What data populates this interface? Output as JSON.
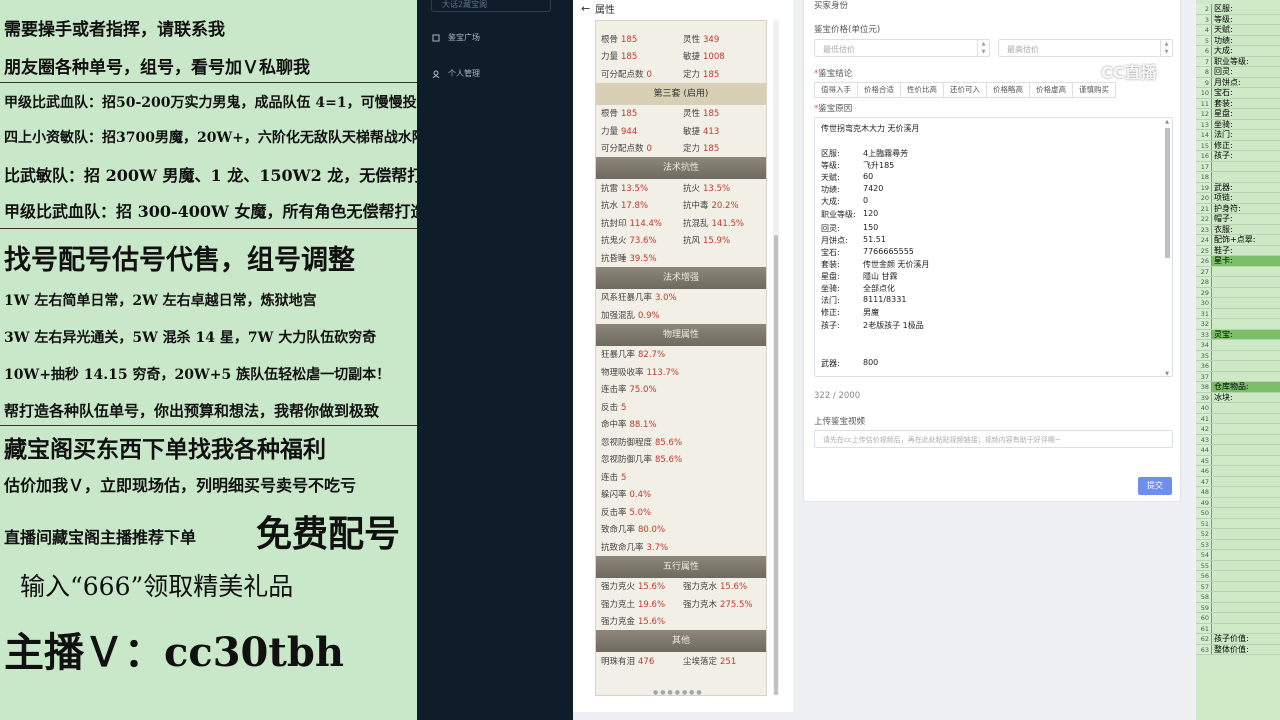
{
  "ad_panel": {
    "lines": [
      "需要操手或者指挥，请联系我",
      "朋友圈各种单号，组号，看号加Ｖ私聊我",
      "甲级比武血队：招50-200万实力男鬼，成品队伍 4=1，可慢慢投资",
      "四上小资敏队：招3700男魔，20W+，六阶化无敌队天梯帮战水陆 4 等 1",
      "比武敏队：招 200W 男魔、1 龙、150W2 龙，无偿帮打造",
      "甲级比武血队：招 300-400W 女魔，所有角色无偿帮打造",
      "找号配号估号代售，组号调整",
      "1W 左右简单日常，2W 左右卓越日常，炼狱地宫",
      "3W 左右异光通关，5W 混杀 14 星，7W 大力队伍砍穷奇",
      "10W+抽秒 14.15 穷奇，20W+5 族队伍轻松虐一切副本！",
      "帮打造各种队伍单号，你出预算和想法，我帮你做到极致",
      "藏宝阁买东西下单找我各种福利",
      "估价加我Ｖ，立即现场估，列明细买号卖号不吃亏",
      "直播间藏宝阁主播推荐下单",
      "免费配号",
      "输入“666”领取精美礼品",
      "主播Ｖ：cc30tbh"
    ]
  },
  "nav": {
    "top_box": "大话2藏宝阁",
    "items": [
      {
        "label": "鉴宝广场",
        "icon": "plaza-icon"
      },
      {
        "label": "个人管理",
        "icon": "user-icon"
      }
    ]
  },
  "props_panel": {
    "title": "属性",
    "set2_rows": [
      [
        {
          "k": "根骨",
          "v": "185"
        },
        {
          "k": "灵性",
          "v": "349"
        }
      ],
      [
        {
          "k": "力量",
          "v": "185"
        },
        {
          "k": "敏捷",
          "v": "1008"
        }
      ],
      [
        {
          "k": "可分配点数",
          "v": "0"
        },
        {
          "k": "定力",
          "v": "185"
        }
      ]
    ],
    "set3_title": "第三套 (启用)",
    "set3_rows": [
      [
        {
          "k": "根骨",
          "v": "185"
        },
        {
          "k": "灵性",
          "v": "185"
        }
      ],
      [
        {
          "k": "力量",
          "v": "944"
        },
        {
          "k": "敏捷",
          "v": "413"
        }
      ],
      [
        {
          "k": "可分配点数",
          "v": "0"
        },
        {
          "k": "定力",
          "v": "185"
        }
      ]
    ],
    "resist_title": "法术抗性",
    "resist_rows": [
      [
        {
          "k": "抗雷",
          "v": "13.5%"
        },
        {
          "k": "抗火",
          "v": "13.5%"
        }
      ],
      [
        {
          "k": "抗水",
          "v": "17.8%"
        },
        {
          "k": "抗中毒",
          "v": "20.2%"
        }
      ],
      [
        {
          "k": "抗封印",
          "v": "114.4%"
        },
        {
          "k": "抗混乱",
          "v": "141.5%"
        }
      ],
      [
        {
          "k": "抗鬼火",
          "v": "73.6%"
        },
        {
          "k": "抗风",
          "v": "15.9%"
        }
      ],
      [
        {
          "k": "抗昏睡",
          "v": "39.5%"
        }
      ]
    ],
    "boost_title": "法术增强",
    "boost_rows": [
      [
        {
          "k": "风系狂暴几率",
          "v": "3.0%"
        }
      ],
      [
        {
          "k": "加强混乱",
          "v": "0.9%"
        }
      ]
    ],
    "phys_title": "物理属性",
    "phys_rows": [
      [
        {
          "k": "狂暴几率",
          "v": "82.7%"
        }
      ],
      [
        {
          "k": "物理吸收率",
          "v": "113.7%"
        }
      ],
      [
        {
          "k": "连击率",
          "v": "75.0%"
        }
      ],
      [
        {
          "k": "反击",
          "v": "5"
        }
      ],
      [
        {
          "k": "命中率",
          "v": "88.1%"
        }
      ],
      [
        {
          "k": "忽视防御程度",
          "v": "85.6%"
        }
      ],
      [
        {
          "k": "忽视防御几率",
          "v": "85.6%"
        }
      ],
      [
        {
          "k": "连击",
          "v": "5"
        }
      ],
      [
        {
          "k": "躲闪率",
          "v": "0.4%"
        }
      ],
      [
        {
          "k": "反击率",
          "v": "5.0%"
        }
      ],
      [
        {
          "k": "致命几率",
          "v": "80.0%"
        }
      ],
      [
        {
          "k": "抗致命几率",
          "v": "3.7%"
        }
      ]
    ],
    "elem_title": "五行属性",
    "elem_rows": [
      [
        {
          "k": "强力克火",
          "v": "15.6%"
        },
        {
          "k": "强力克水",
          "v": "15.6%"
        }
      ],
      [
        {
          "k": "强力克土",
          "v": "19.6%"
        },
        {
          "k": "强力克木",
          "v": "275.5%"
        }
      ],
      [
        {
          "k": "强力克金",
          "v": "15.6%"
        }
      ]
    ],
    "other_title": "其他",
    "other_rows": [
      [
        {
          "k": "明珠有泪",
          "v": "476"
        },
        {
          "k": "尘埃落定",
          "v": "251"
        }
      ]
    ]
  },
  "form": {
    "section_title": "买家身份",
    "price_label": "鉴宝价格(单位元)",
    "min_placeholder": "最低估价",
    "max_placeholder": "最高估价",
    "conclusion_label": "鉴宝结论",
    "tags": [
      "值得入手",
      "价格合适",
      "性价比高",
      "还价可入",
      "价格略高",
      "价格虚高",
      "谨慎购买"
    ],
    "reason_label": "鉴宝原因",
    "reason_title": "传世拐弯克木大力 无价溪月",
    "reason_rows": [
      {
        "k": "区服:",
        "v": "4上臨霧尋芳"
      },
      {
        "k": "等级:",
        "v": "飞升185"
      },
      {
        "k": "天赋:",
        "v": "60"
      },
      {
        "k": "功绩:",
        "v": "7420"
      },
      {
        "k": "大成:",
        "v": "0"
      },
      {
        "k": "职业等级:",
        "v": "120"
      },
      {
        "k": "回灵:",
        "v": "150"
      },
      {
        "k": "月饼点:",
        "v": "51.51"
      },
      {
        "k": "宝石:",
        "v": "7766665555"
      },
      {
        "k": "套装:",
        "v": "传世金颜 无价溪月"
      },
      {
        "k": "星盘:",
        "v": "隱山 甘霖"
      },
      {
        "k": "坐骑:",
        "v": "全部点化"
      },
      {
        "k": "法门:",
        "v": "8111/8331"
      },
      {
        "k": "修正:",
        "v": "男魔"
      },
      {
        "k": "孩子:",
        "v": "2老版孩子 1极品"
      },
      {
        "k": "武器:",
        "v": "800"
      }
    ],
    "char_count": "322 / 2000",
    "video_label": "上传鉴宝视频",
    "video_placeholder": "请先在cc上传估价视频后，再在此处粘贴视频链接；视频内容有助于好评噢~",
    "submit_label": "提交"
  },
  "watermark": "CC直播",
  "sheet": {
    "rows": [
      {
        "n": "2",
        "c": "区服:"
      },
      {
        "n": "3",
        "c": "等级:"
      },
      {
        "n": "4",
        "c": "天赋:"
      },
      {
        "n": "5",
        "c": "功绩:"
      },
      {
        "n": "6",
        "c": "大成:"
      },
      {
        "n": "7",
        "c": "职业等级:"
      },
      {
        "n": "8",
        "c": "回灵:"
      },
      {
        "n": "9",
        "c": "月饼点:"
      },
      {
        "n": "10",
        "c": "宝石:"
      },
      {
        "n": "11",
        "c": "套装:"
      },
      {
        "n": "12",
        "c": "星盘:"
      },
      {
        "n": "13",
        "c": "坐骑:"
      },
      {
        "n": "14",
        "c": "法门:"
      },
      {
        "n": "15",
        "c": "修正:"
      },
      {
        "n": "16",
        "c": "孩子:"
      },
      {
        "n": "17",
        "c": ""
      },
      {
        "n": "18",
        "c": ""
      },
      {
        "n": "19",
        "c": "武器:"
      },
      {
        "n": "20",
        "c": "项链:"
      },
      {
        "n": "21",
        "c": "护身符:"
      },
      {
        "n": "22",
        "c": "帽子:"
      },
      {
        "n": "23",
        "c": "衣服:"
      },
      {
        "n": "24",
        "c": "配饰+点翠:"
      },
      {
        "n": "25",
        "c": "鞋子:"
      },
      {
        "n": "26",
        "c": "星卡:",
        "hl": true
      },
      {
        "n": "27",
        "c": ""
      },
      {
        "n": "28",
        "c": ""
      },
      {
        "n": "29",
        "c": ""
      },
      {
        "n": "30",
        "c": ""
      },
      {
        "n": "31",
        "c": ""
      },
      {
        "n": "32",
        "c": ""
      },
      {
        "n": "33",
        "c": "灵宝:",
        "hl": true
      },
      {
        "n": "34",
        "c": ""
      },
      {
        "n": "35",
        "c": ""
      },
      {
        "n": "36",
        "c": ""
      },
      {
        "n": "37",
        "c": ""
      },
      {
        "n": "38",
        "c": "仓库物品:",
        "hl": true
      },
      {
        "n": "39",
        "c": "冰块:"
      },
      {
        "n": "40",
        "c": ""
      },
      {
        "n": "41",
        "c": ""
      },
      {
        "n": "42",
        "c": ""
      },
      {
        "n": "43",
        "c": ""
      },
      {
        "n": "44",
        "c": ""
      },
      {
        "n": "45",
        "c": ""
      },
      {
        "n": "46",
        "c": ""
      },
      {
        "n": "47",
        "c": ""
      },
      {
        "n": "48",
        "c": ""
      },
      {
        "n": "49",
        "c": ""
      },
      {
        "n": "50",
        "c": ""
      },
      {
        "n": "51",
        "c": ""
      },
      {
        "n": "52",
        "c": ""
      },
      {
        "n": "53",
        "c": ""
      },
      {
        "n": "54",
        "c": ""
      },
      {
        "n": "55",
        "c": ""
      },
      {
        "n": "56",
        "c": ""
      },
      {
        "n": "57",
        "c": ""
      },
      {
        "n": "58",
        "c": ""
      },
      {
        "n": "59",
        "c": ""
      },
      {
        "n": "60",
        "c": ""
      },
      {
        "n": "61",
        "c": ""
      },
      {
        "n": "62",
        "c": "孩子价值:"
      },
      {
        "n": "63",
        "c": "整体价值:"
      }
    ]
  }
}
